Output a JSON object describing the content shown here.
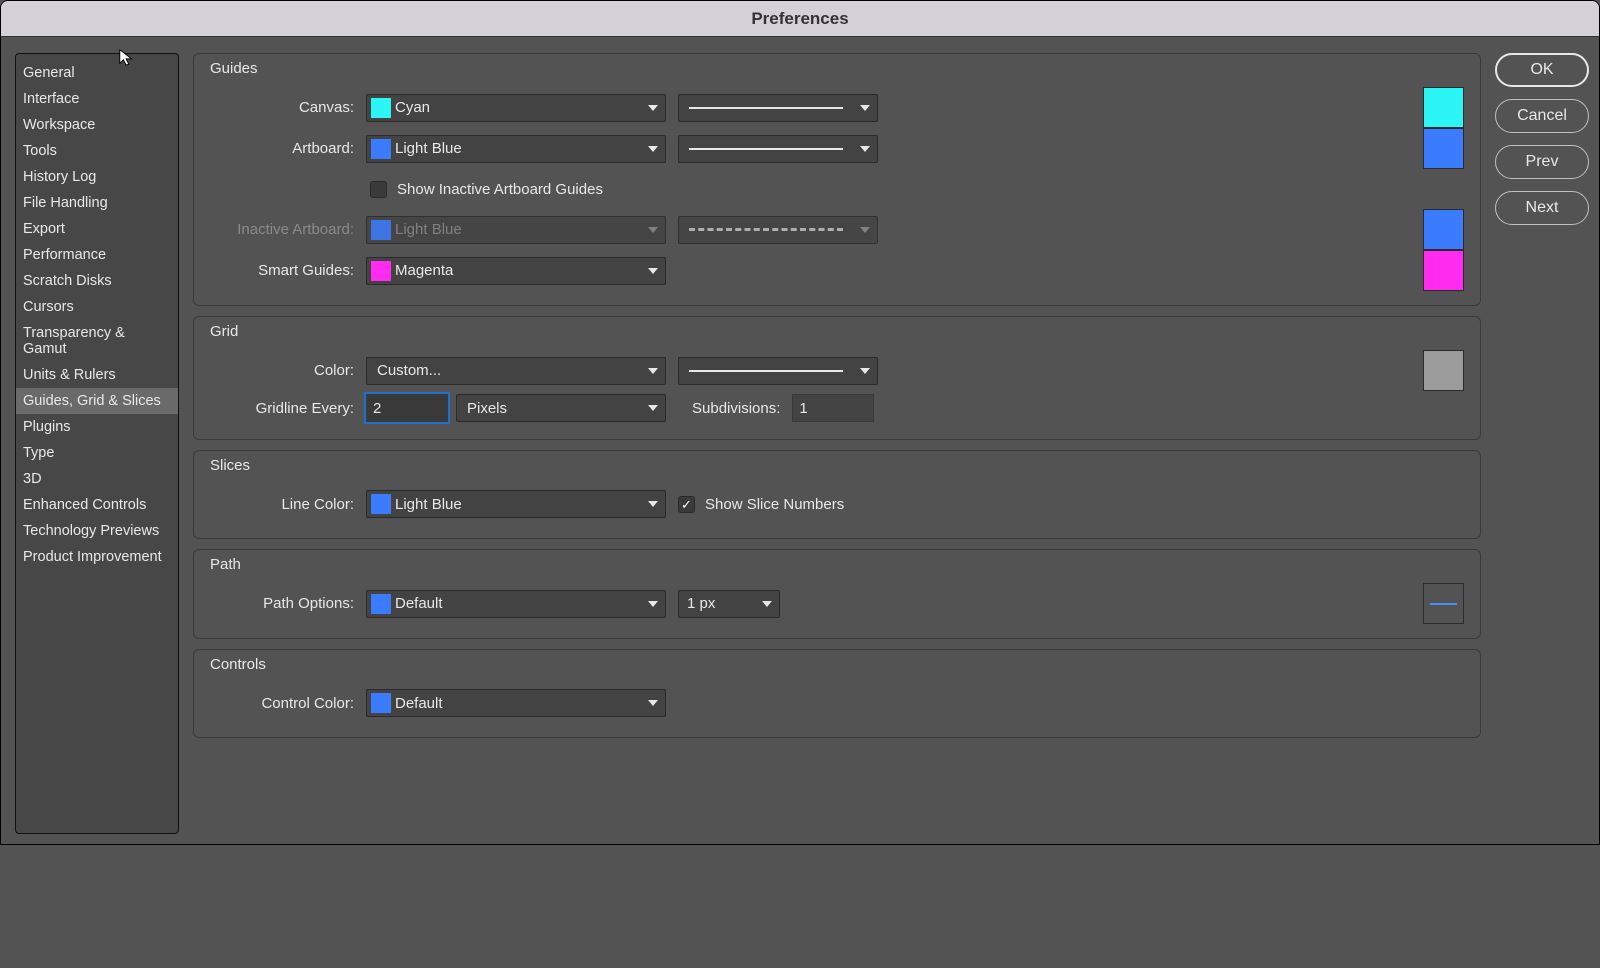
{
  "title": "Preferences",
  "sidebar": {
    "items": [
      {
        "label": "General"
      },
      {
        "label": "Interface"
      },
      {
        "label": "Workspace"
      },
      {
        "label": "Tools"
      },
      {
        "label": "History Log"
      },
      {
        "label": "File Handling"
      },
      {
        "label": "Export"
      },
      {
        "label": "Performance"
      },
      {
        "label": "Scratch Disks"
      },
      {
        "label": "Cursors"
      },
      {
        "label": "Transparency & Gamut"
      },
      {
        "label": "Units & Rulers"
      },
      {
        "label": "Guides, Grid & Slices"
      },
      {
        "label": "Plugins"
      },
      {
        "label": "Type"
      },
      {
        "label": "3D"
      },
      {
        "label": "Enhanced Controls"
      },
      {
        "label": "Technology Previews"
      },
      {
        "label": "Product Improvement"
      }
    ],
    "selected_index": 12
  },
  "guides": {
    "title": "Guides",
    "canvas_label": "Canvas:",
    "canvas_value": "Cyan",
    "canvas_swatch": "#2cf5f5",
    "artboard_label": "Artboard:",
    "artboard_value": "Light Blue",
    "artboard_swatch": "#3b7cff",
    "show_inactive_label": "Show Inactive Artboard Guides",
    "show_inactive_checked": false,
    "inactive_label": "Inactive Artboard:",
    "inactive_value": "Light Blue",
    "inactive_swatch": "#3b7cff",
    "smart_label": "Smart Guides:",
    "smart_value": "Magenta",
    "smart_swatch": "#ff2cf0"
  },
  "grid": {
    "title": "Grid",
    "color_label": "Color:",
    "color_value": "Custom...",
    "color_swatch": "#9b9b9b",
    "gridline_label": "Gridline Every:",
    "gridline_value": "2",
    "gridline_unit": "Pixels",
    "subdiv_label": "Subdivisions:",
    "subdiv_value": "1"
  },
  "slices": {
    "title": "Slices",
    "linecolor_label": "Line Color:",
    "linecolor_value": "Light Blue",
    "linecolor_swatch": "#3b7cff",
    "show_numbers_label": "Show Slice Numbers",
    "show_numbers_checked": true
  },
  "path": {
    "title": "Path",
    "options_label": "Path Options:",
    "options_value": "Default",
    "options_swatch": "#3b7cff",
    "thickness_value": "1 px"
  },
  "controls": {
    "title": "Controls",
    "color_label": "Control Color:",
    "color_value": "Default",
    "color_swatch": "#3b7cff"
  },
  "buttons": {
    "ok": "OK",
    "cancel": "Cancel",
    "prev": "Prev",
    "next": "Next"
  }
}
